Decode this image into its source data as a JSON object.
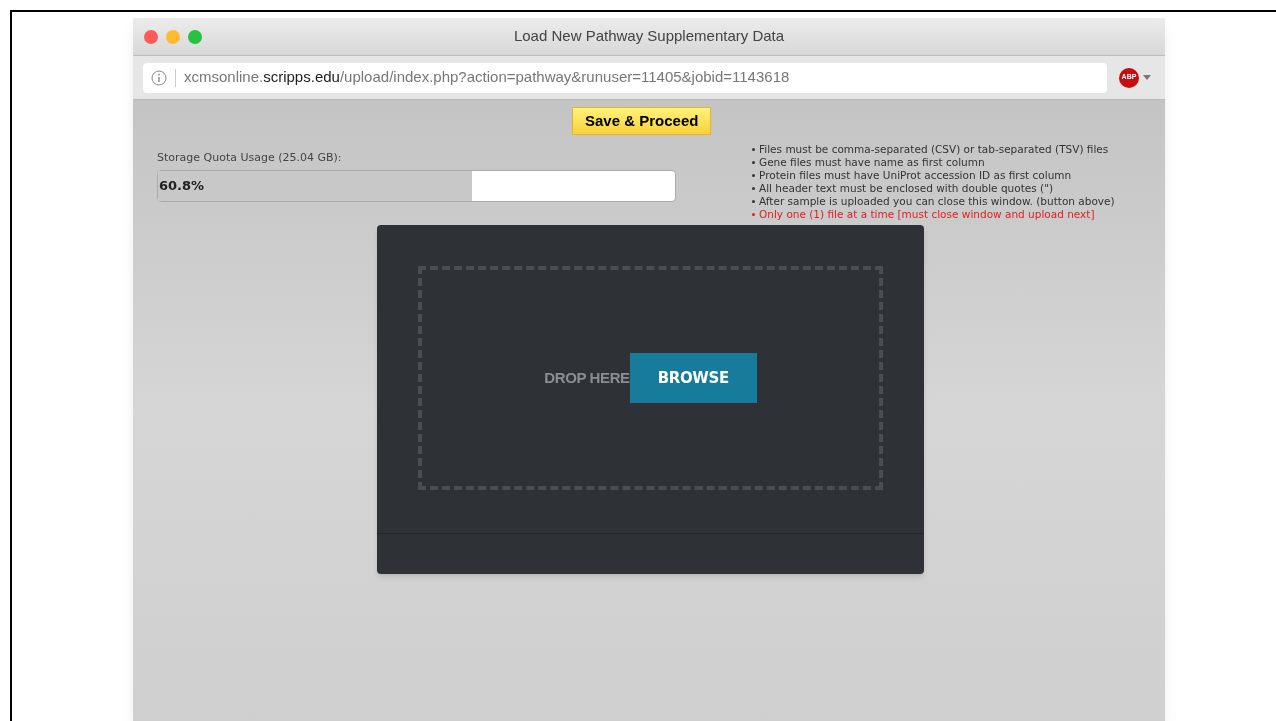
{
  "window": {
    "title": "Load New Pathway Supplementary Data"
  },
  "address_bar": {
    "host_prefix": "xcmsonline.",
    "domain": "scripps.edu",
    "path": "/upload/index.php?action=pathway&runuser=11405&jobid=1143618"
  },
  "adblock": {
    "label": "ABP"
  },
  "save_button": "Save & Proceed",
  "storage": {
    "label": "Storage Quota Usage (25.04 GB):",
    "reading": "60.8%",
    "level": 0.608
  },
  "notes": [
    {
      "kind": "normal",
      "text": "Files must be comma-separated (CSV) or tab-separated (TSV) files"
    },
    {
      "kind": "normal",
      "text": "Gene files must have name as first column"
    },
    {
      "kind": "normal",
      "text": "Protein files must have UniProt accession ID as first column"
    },
    {
      "kind": "normal",
      "text": "All header text must be enclosed with double quotes (\")"
    },
    {
      "kind": "normal",
      "text": "After sample is uploaded you can close this window. (button above)"
    },
    {
      "kind": "warning",
      "text": "Only one (1) file at a time [must close window and upload next]"
    }
  ],
  "dropzone": {
    "hint": "DROP HERE",
    "button": "BROWSE"
  }
}
